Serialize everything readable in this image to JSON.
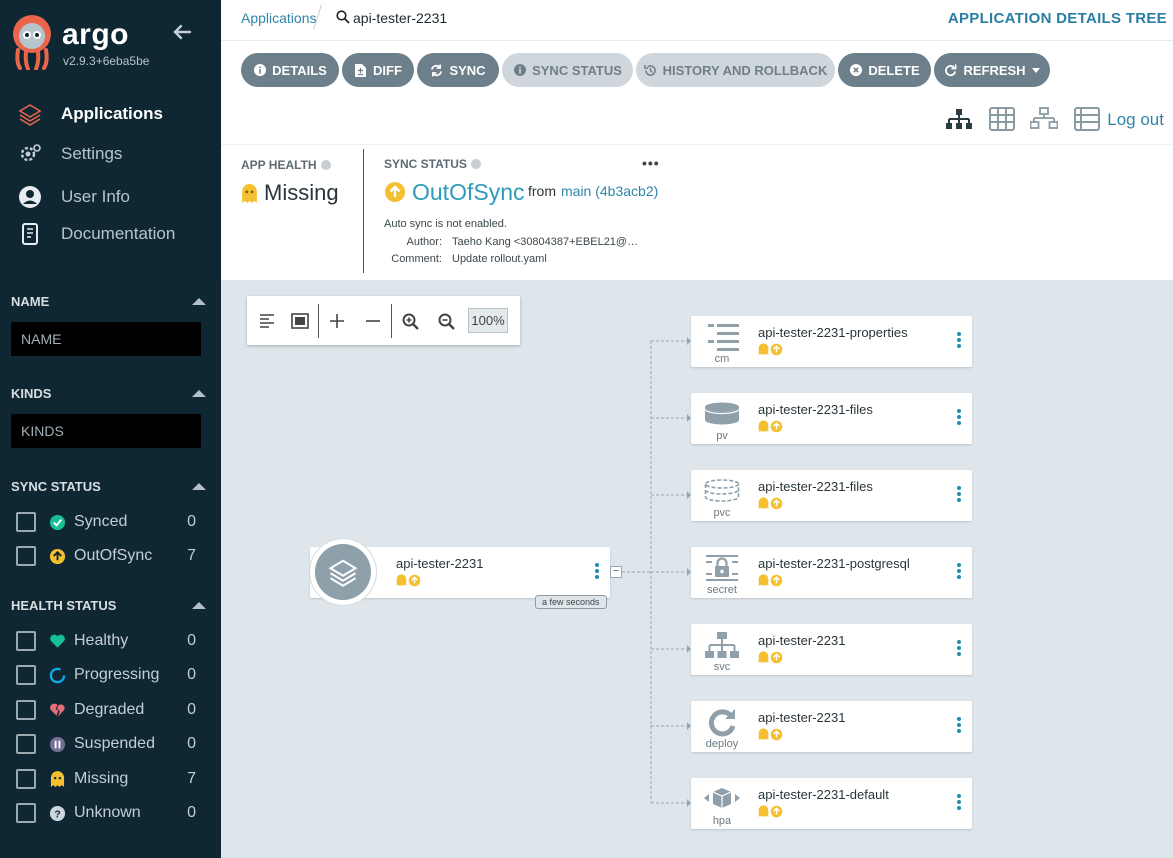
{
  "sidebar": {
    "brand": "argo",
    "version": "v2.9.3+6eba5be",
    "nav": [
      {
        "label": "Applications",
        "icon": "layers-icon",
        "active": true
      },
      {
        "label": "Settings",
        "icon": "gears-icon"
      },
      {
        "label": "User Info",
        "icon": "user-circle-icon"
      },
      {
        "label": "Documentation",
        "icon": "book-icon"
      }
    ],
    "filters": {
      "name": {
        "title": "NAME",
        "placeholder": "NAME"
      },
      "kinds": {
        "title": "KINDS",
        "placeholder": "KINDS"
      },
      "sync_status": {
        "title": "SYNC STATUS",
        "items": [
          {
            "label": "Synced",
            "count": "0",
            "color": "#18be94"
          },
          {
            "label": "OutOfSync",
            "count": "7",
            "color": "#f4c030"
          }
        ]
      },
      "health_status": {
        "title": "HEALTH STATUS",
        "items": [
          {
            "label": "Healthy",
            "count": "0",
            "color": "#18be94"
          },
          {
            "label": "Progressing",
            "count": "0",
            "color": "#0dadea"
          },
          {
            "label": "Degraded",
            "count": "0",
            "color": "#e96d76"
          },
          {
            "label": "Suspended",
            "count": "0",
            "color": "#766f94"
          },
          {
            "label": "Missing",
            "count": "7",
            "color": "#f4c030"
          },
          {
            "label": "Unknown",
            "count": "0",
            "color": "#ccd6dd"
          }
        ]
      }
    }
  },
  "topbar": {
    "breadcrumb_link": "Applications",
    "current": "api-tester-2231",
    "title": "APPLICATION DETAILS TREE"
  },
  "toolbar": {
    "buttons": [
      {
        "label": "DETAILS",
        "icon": "info-icon"
      },
      {
        "label": "DIFF",
        "icon": "file-diff-icon"
      },
      {
        "label": "SYNC",
        "icon": "sync-icon"
      },
      {
        "label": "SYNC STATUS",
        "icon": "info-icon",
        "disabled": true
      },
      {
        "label": "HISTORY AND ROLLBACK",
        "icon": "history-icon",
        "disabled": true
      },
      {
        "label": "DELETE",
        "icon": "times-circle-icon"
      },
      {
        "label": "REFRESH",
        "icon": "redo-icon"
      }
    ],
    "logout": "Log out"
  },
  "status": {
    "app_health_label": "APP HEALTH",
    "app_health_value": "Missing",
    "sync_status_label": "SYNC STATUS",
    "sync_value": "OutOfSync",
    "from": "from",
    "revision": "main (4b3acb2)",
    "more": "•••",
    "auto_sync": "Auto sync is not enabled.",
    "author_label": "Author:",
    "author_value": "Taeho Kang <30804387+EBEL21@…",
    "comment_label": "Comment:",
    "comment_value": "Update rollout.yaml"
  },
  "graph": {
    "zoom": "100%",
    "app": {
      "name": "api-tester-2231",
      "age": "a few seconds",
      "collapse": "−"
    },
    "resources": [
      {
        "name": "api-tester-2231-properties",
        "kind": "cm",
        "icon": "list-icon"
      },
      {
        "name": "api-tester-2231-files",
        "kind": "pv",
        "icon": "database-icon"
      },
      {
        "name": "api-tester-2231-files",
        "kind": "pvc",
        "icon": "database-dashed-icon"
      },
      {
        "name": "api-tester-2231-postgresql",
        "kind": "secret",
        "icon": "lock-icon"
      },
      {
        "name": "api-tester-2231",
        "kind": "svc",
        "icon": "network-icon"
      },
      {
        "name": "api-tester-2231",
        "kind": "deploy",
        "icon": "redo-icon"
      },
      {
        "name": "api-tester-2231-default",
        "kind": "hpa",
        "icon": "cube-arrows-icon"
      }
    ]
  },
  "colors": {
    "sidebar": "#0f2733",
    "accent": "#2f86a8",
    "missing": "#f4c030",
    "outofsync": "#f4c030",
    "button": "#6d7f8b"
  }
}
